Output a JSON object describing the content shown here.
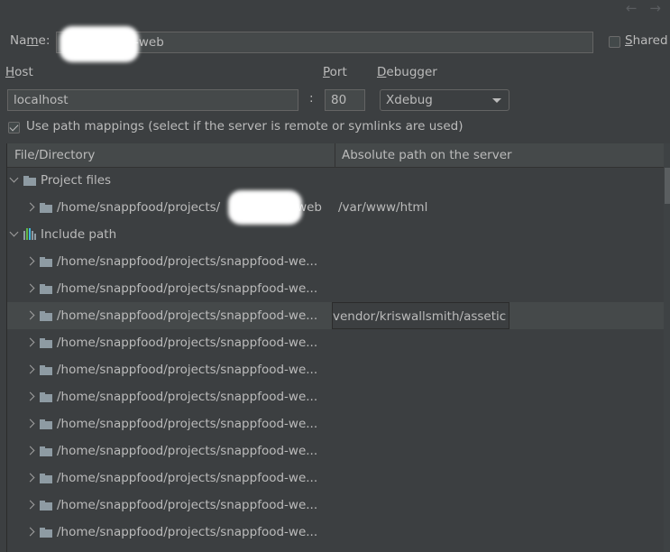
{
  "nav": {
    "back_icon": "←",
    "forward_icon": "→"
  },
  "form": {
    "name_label": "Name:",
    "name_value": "-web",
    "shared_label": "Shared",
    "shared_checked": false,
    "host_label": "Host",
    "host_value": "localhost",
    "port_label": "Port",
    "port_value": "80",
    "colon": ":",
    "debugger_label": "Debugger",
    "debugger_value": "Xdebug",
    "use_path_mappings_label": "Use path mappings (select if the server is remote or symlinks are used)",
    "use_path_mappings_checked": true
  },
  "table": {
    "columns": [
      "File/Directory",
      "Absolute path on the server"
    ],
    "groups": [
      {
        "label": "Project files",
        "icon": "folder-icon",
        "expanded": true
      },
      {
        "label": "Include path",
        "icon": "library-icon",
        "expanded": true
      }
    ],
    "project_rows": [
      {
        "path_prefix": "/home/snappfood/projects/",
        "path_suffix": "-web",
        "server_path": "/var/www/html"
      }
    ],
    "include_rows": [
      {
        "path": "/home/snappfood/projects/snappfood-we...",
        "server_path": ""
      },
      {
        "path": "/home/snappfood/projects/snappfood-we...",
        "server_path": ""
      },
      {
        "path": "/home/snappfood/projects/snappfood-we...",
        "server_path": "vendor/kriswallsmith/assetic",
        "selected": true
      },
      {
        "path": "/home/snappfood/projects/snappfood-we...",
        "server_path": ""
      },
      {
        "path": "/home/snappfood/projects/snappfood-we...",
        "server_path": ""
      },
      {
        "path": "/home/snappfood/projects/snappfood-we...",
        "server_path": ""
      },
      {
        "path": "/home/snappfood/projects/snappfood-we...",
        "server_path": ""
      },
      {
        "path": "/home/snappfood/projects/snappfood-we...",
        "server_path": ""
      },
      {
        "path": "/home/snappfood/projects/snappfood-we...",
        "server_path": ""
      },
      {
        "path": "/home/snappfood/projects/snappfood-we...",
        "server_path": ""
      },
      {
        "path": "/home/snappfood/projects/snappfood-we...",
        "server_path": ""
      }
    ]
  },
  "colors": {
    "background": "#3c3f41",
    "input_bg": "#45494a",
    "text": "#bbbbbb",
    "folder": "#8e9ba3"
  }
}
